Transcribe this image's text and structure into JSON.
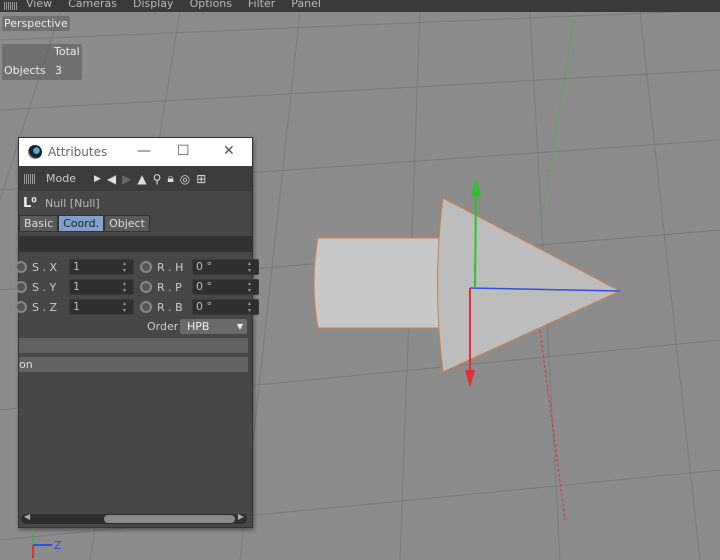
{
  "menubar": {
    "items": [
      "View",
      "Cameras",
      "Display",
      "Options",
      "Filter",
      "Panel"
    ]
  },
  "viewport": {
    "camera_label": "Perspective",
    "stats": {
      "header": "Total",
      "row_label": "Objects",
      "row_value": "3"
    },
    "axis_label": "Z"
  },
  "attributes": {
    "title": "Attributes",
    "toolbar": {
      "mode_label": "Mode"
    },
    "object_name": "Null [Null]",
    "tabs": [
      {
        "label": "Basic",
        "active": false
      },
      {
        "label": "Coord.",
        "active": true
      },
      {
        "label": "Object",
        "active": false
      }
    ],
    "scale": [
      {
        "label": "S . X",
        "value": "1"
      },
      {
        "label": "S . Y",
        "value": "1"
      },
      {
        "label": "S . Z",
        "value": "1"
      }
    ],
    "rotation": [
      {
        "label": "R . H",
        "value": "0 °"
      },
      {
        "label": "R . P",
        "value": "0 °"
      },
      {
        "label": "R . B",
        "value": "0 °"
      }
    ],
    "order_label": "Order",
    "order_value": "HPB",
    "section_partial": "on"
  },
  "colors": {
    "x_axis": "#e03030",
    "y_axis": "#30c030",
    "z_axis": "#3050e0",
    "active_tab": "#7fa2cc",
    "highlight": "#d08040"
  }
}
